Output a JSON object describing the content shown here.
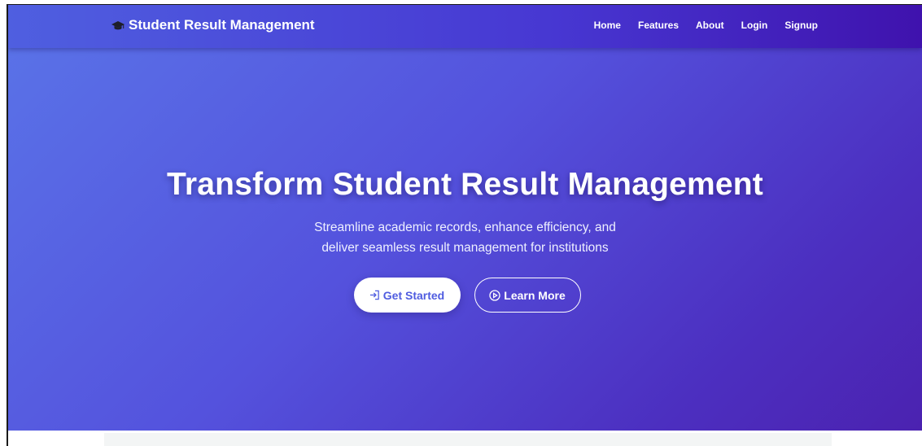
{
  "navbar": {
    "brand_icon": "graduation-cap-icon",
    "brand_title": "Student Result Management",
    "links": [
      {
        "label": "Home"
      },
      {
        "label": "Features"
      },
      {
        "label": "About"
      },
      {
        "label": "Login"
      },
      {
        "label": "Signup"
      }
    ]
  },
  "hero": {
    "title": "Transform Student Result Management",
    "subtitle_line1": "Streamline academic records, enhance efficiency, and",
    "subtitle_line2": "deliver seamless result management for institutions",
    "primary_button": {
      "label": "Get Started",
      "icon": "sign-in-icon"
    },
    "secondary_button": {
      "label": "Learn More",
      "icon": "play-circle-icon"
    }
  },
  "colors": {
    "gradient_start": "#5a74e8",
    "gradient_end": "#4b22b0",
    "primary_button_text": "#4f5ce0"
  }
}
